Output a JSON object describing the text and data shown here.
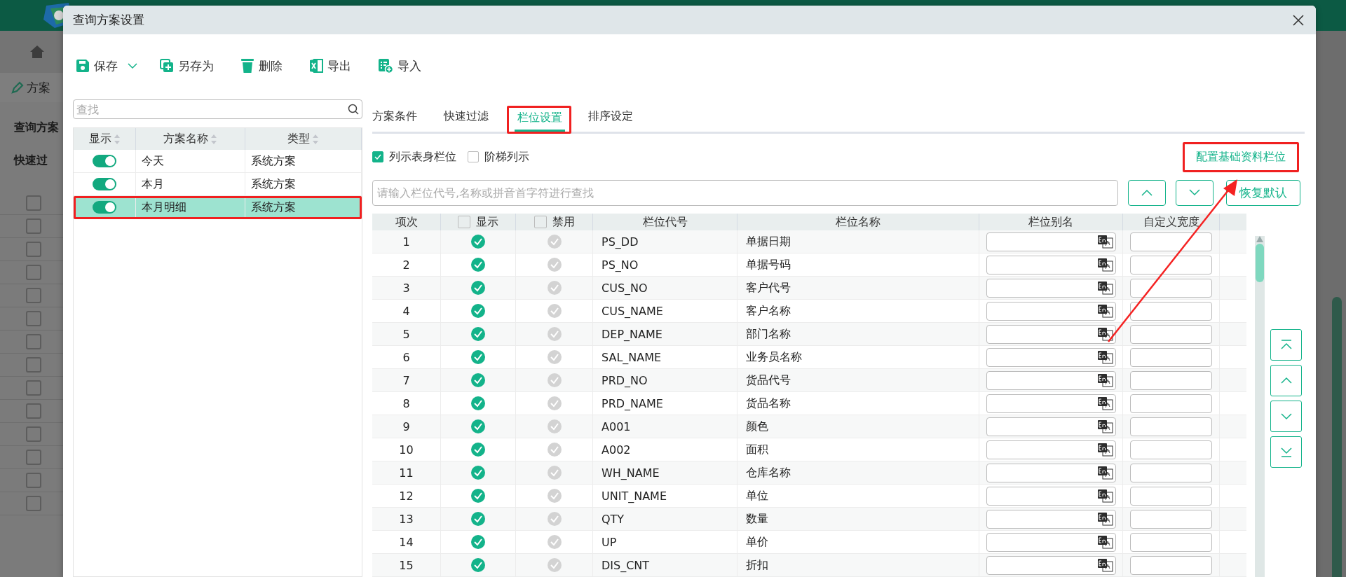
{
  "background": {
    "tab": "方案",
    "labels": [
      "查询方案",
      "快速过"
    ],
    "rows": [
      {
        "checked": false
      },
      {
        "checked": false
      },
      {
        "checked": false
      },
      {
        "checked": false
      },
      {
        "checked": false
      },
      {
        "checked": false
      },
      {
        "checked": false
      },
      {
        "checked": false
      },
      {
        "checked": false
      },
      {
        "checked": false
      },
      {
        "checked": false
      },
      {
        "checked": false
      },
      {
        "checked": false
      },
      {
        "checked": false
      }
    ]
  },
  "dialog": {
    "title": "查询方案设置",
    "toolbar": [
      {
        "label": "保存",
        "dropdown": true
      },
      {
        "label": "另存为",
        "dropdown": false
      },
      {
        "label": "删除",
        "dropdown": false
      },
      {
        "label": "导出",
        "dropdown": false
      },
      {
        "label": "导入",
        "dropdown": false
      }
    ],
    "scheme_search": {
      "placeholder": "查找"
    },
    "scheme_table": {
      "columns": [
        {
          "label": "显示",
          "sortable": true
        },
        {
          "label": "方案名称",
          "sortable": true
        },
        {
          "label": "类型",
          "sortable": true
        }
      ],
      "rows": [
        {
          "on": true,
          "name": "今天",
          "type": "系统方案",
          "selected": false
        },
        {
          "on": true,
          "name": "本月",
          "type": "系统方案",
          "selected": false
        },
        {
          "on": true,
          "name": "本月明细",
          "type": "系统方案",
          "selected": true
        }
      ]
    },
    "tabs": [
      {
        "label": "方案条件",
        "selected": false
      },
      {
        "label": "快速过滤",
        "selected": false
      },
      {
        "label": "栏位设置",
        "selected": true
      },
      {
        "label": "排序设定",
        "selected": false
      }
    ],
    "options": [
      {
        "label": "列示表身栏位",
        "checked": true
      },
      {
        "label": "阶梯列示",
        "checked": false
      }
    ],
    "config_link": "配置基础资料栏位",
    "field_search": {
      "placeholder": "请输入栏位代号,名称或拼音首字符进行查找"
    },
    "restore_button": "恢复默认",
    "field_table": {
      "columns": [
        {
          "label": "项次",
          "kind": "text"
        },
        {
          "label": "显示",
          "kind": "check",
          "checked": false
        },
        {
          "label": "禁用",
          "kind": "check",
          "checked": false
        },
        {
          "label": "栏位代号",
          "kind": "text"
        },
        {
          "label": "栏位名称",
          "kind": "text"
        },
        {
          "label": "栏位别名",
          "kind": "text"
        },
        {
          "label": "自定义宽度",
          "kind": "text"
        }
      ],
      "rows": [
        {
          "index": "1",
          "shown": true,
          "disabled": false,
          "code": "PS_DD",
          "name": "单据日期"
        },
        {
          "index": "2",
          "shown": true,
          "disabled": false,
          "code": "PS_NO",
          "name": "单据号码"
        },
        {
          "index": "3",
          "shown": true,
          "disabled": false,
          "code": "CUS_NO",
          "name": "客户代号"
        },
        {
          "index": "4",
          "shown": true,
          "disabled": false,
          "code": "CUS_NAME",
          "name": "客户名称"
        },
        {
          "index": "5",
          "shown": true,
          "disabled": false,
          "code": "DEP_NAME",
          "name": "部门名称"
        },
        {
          "index": "6",
          "shown": true,
          "disabled": false,
          "code": "SAL_NAME",
          "name": "业务员名称"
        },
        {
          "index": "7",
          "shown": true,
          "disabled": false,
          "code": "PRD_NO",
          "name": "货品代号"
        },
        {
          "index": "8",
          "shown": true,
          "disabled": false,
          "code": "PRD_NAME",
          "name": "货品名称"
        },
        {
          "index": "9",
          "shown": true,
          "disabled": false,
          "code": "A001",
          "name": "颜色"
        },
        {
          "index": "10",
          "shown": true,
          "disabled": false,
          "code": "A002",
          "name": "面积"
        },
        {
          "index": "11",
          "shown": true,
          "disabled": false,
          "code": "WH_NAME",
          "name": "仓库名称"
        },
        {
          "index": "12",
          "shown": true,
          "disabled": false,
          "code": "UNIT_NAME",
          "name": "单位"
        },
        {
          "index": "13",
          "shown": true,
          "disabled": false,
          "code": "QTY",
          "name": "数量"
        },
        {
          "index": "14",
          "shown": true,
          "disabled": false,
          "code": "UP",
          "name": "单价"
        },
        {
          "index": "15",
          "shown": true,
          "disabled": false,
          "code": "DIS_CNT",
          "name": "折扣"
        }
      ]
    }
  }
}
